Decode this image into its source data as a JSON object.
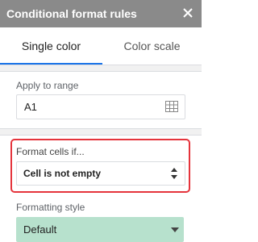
{
  "panel": {
    "title": "Conditional format rules"
  },
  "tabs": [
    {
      "label": "Single color",
      "active": true
    },
    {
      "label": "Color scale",
      "active": false
    }
  ],
  "apply_range": {
    "label": "Apply to range",
    "value": "A1",
    "icon": "grid-icon"
  },
  "format_cells": {
    "label": "Format cells if...",
    "selected": "Cell is not empty",
    "icon": "up-down-arrow-icon"
  },
  "formatting_style": {
    "label": "Formatting style",
    "selected": "Default",
    "icon": "caret-down-icon"
  },
  "colors": {
    "header_bg": "#8a8a8a",
    "accent": "#1a73e8",
    "highlight_border": "#e5343c",
    "style_bg": "#b7e1cd"
  }
}
